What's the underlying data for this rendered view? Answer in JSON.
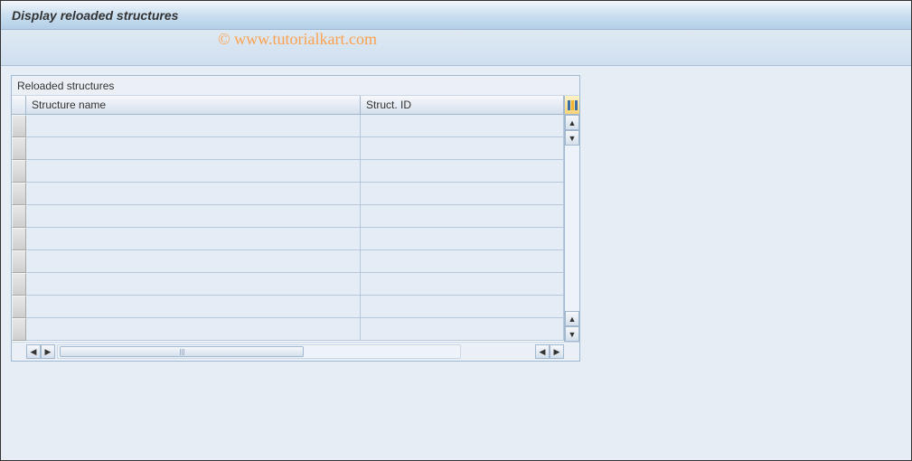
{
  "window": {
    "title": "Display reloaded structures"
  },
  "panel": {
    "title": "Reloaded structures",
    "columns": [
      {
        "label": "Structure name"
      },
      {
        "label": "Struct. ID"
      }
    ],
    "rows": [
      {
        "name": "",
        "id": ""
      },
      {
        "name": "",
        "id": ""
      },
      {
        "name": "",
        "id": ""
      },
      {
        "name": "",
        "id": ""
      },
      {
        "name": "",
        "id": ""
      },
      {
        "name": "",
        "id": ""
      },
      {
        "name": "",
        "id": ""
      },
      {
        "name": "",
        "id": ""
      },
      {
        "name": "",
        "id": ""
      },
      {
        "name": "",
        "id": ""
      }
    ]
  },
  "watermark": "© www.tutorialkart.com"
}
